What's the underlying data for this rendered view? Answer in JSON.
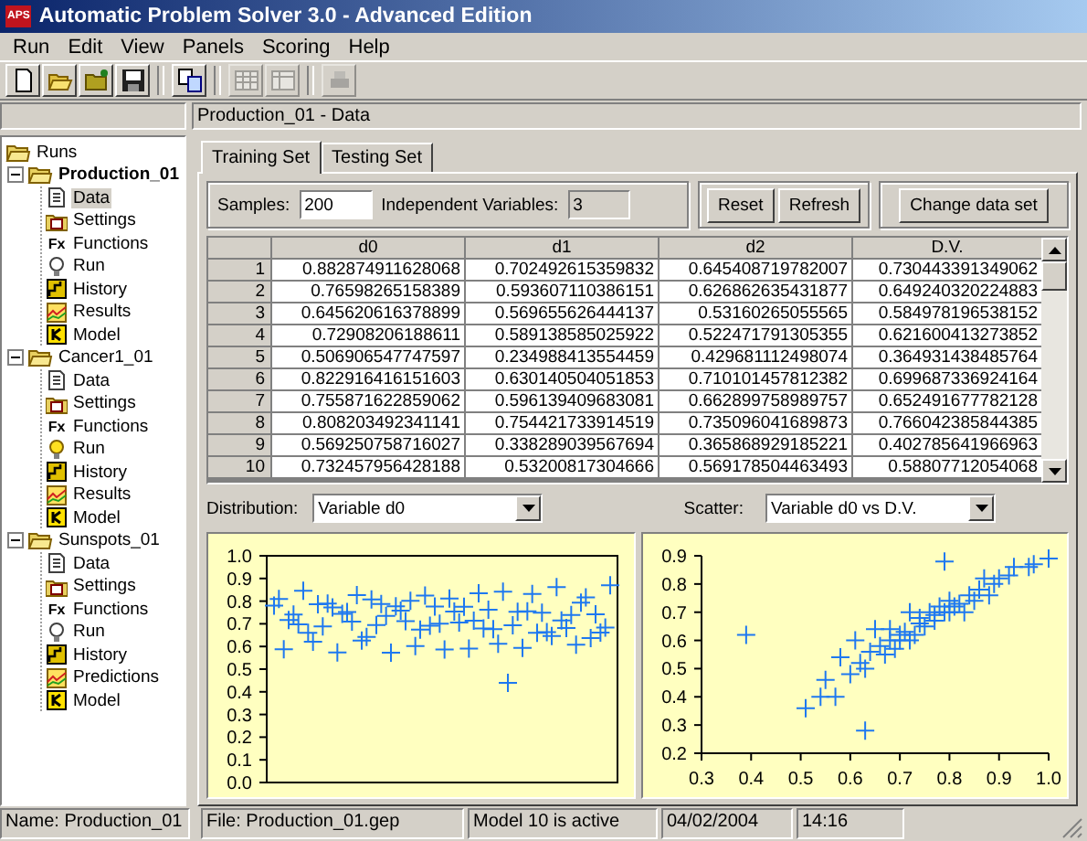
{
  "window": {
    "icon_text": "APS",
    "title": "Automatic Problem Solver 3.0 - Advanced Edition"
  },
  "menu": [
    "Run",
    "Edit",
    "View",
    "Panels",
    "Scoring",
    "Help"
  ],
  "toolbar": [
    [
      {
        "kind": "new",
        "disabled": false
      },
      {
        "kind": "open",
        "disabled": false
      },
      {
        "kind": "open_project",
        "disabled": false
      },
      {
        "kind": "save",
        "disabled": false
      }
    ],
    [
      {
        "kind": "copy",
        "disabled": false
      }
    ],
    [
      {
        "kind": "grid",
        "disabled": true
      },
      {
        "kind": "table",
        "disabled": true
      }
    ],
    [
      {
        "kind": "print",
        "disabled": true
      }
    ]
  ],
  "breadcrumb": "Production_01 - Data",
  "tree": {
    "label": "Runs",
    "children": [
      {
        "label": "Production_01",
        "active": true,
        "expanded": true,
        "children": [
          {
            "label": "Data",
            "kind": "data",
            "selected": true
          },
          {
            "label": "Settings",
            "kind": "settings",
            "selected": false
          },
          {
            "label": "Functions",
            "kind": "functions",
            "icon_text": "Fx",
            "selected": false
          },
          {
            "label": "Run",
            "kind": "run",
            "selected": false
          },
          {
            "label": "History",
            "kind": "history",
            "selected": false
          },
          {
            "label": "Results",
            "kind": "results",
            "selected": false
          },
          {
            "label": "Model",
            "kind": "model",
            "selected": false
          }
        ]
      },
      {
        "label": "Cancer1_01",
        "active": false,
        "expanded": true,
        "children": [
          {
            "label": "Data",
            "kind": "data",
            "selected": false
          },
          {
            "label": "Settings",
            "kind": "settings",
            "selected": false
          },
          {
            "label": "Functions",
            "kind": "functions",
            "icon_text": "Fx",
            "selected": false
          },
          {
            "label": "Run",
            "kind": "run_lit",
            "selected": false
          },
          {
            "label": "History",
            "kind": "history",
            "selected": false
          },
          {
            "label": "Results",
            "kind": "results",
            "selected": false
          },
          {
            "label": "Model",
            "kind": "model",
            "selected": false
          }
        ]
      },
      {
        "label": "Sunspots_01",
        "active": false,
        "expanded": true,
        "children": [
          {
            "label": "Data",
            "kind": "data",
            "selected": false
          },
          {
            "label": "Settings",
            "kind": "settings",
            "selected": false
          },
          {
            "label": "Functions",
            "kind": "functions",
            "icon_text": "Fx",
            "selected": false
          },
          {
            "label": "Run",
            "kind": "run",
            "selected": false
          },
          {
            "label": "History",
            "kind": "history",
            "selected": false
          },
          {
            "label": "Predictions",
            "kind": "results",
            "selected": false
          },
          {
            "label": "Model",
            "kind": "model",
            "selected": false
          }
        ]
      }
    ]
  },
  "tabs": [
    {
      "label": "Training Set",
      "selected": true
    },
    {
      "label": "Testing Set",
      "selected": false
    }
  ],
  "samples": {
    "label": "Samples:",
    "value": "200"
  },
  "independent_variables": {
    "label": "Independent Variables:",
    "value": "3",
    "disabled": true
  },
  "action_buttons": [
    "Reset",
    "Refresh"
  ],
  "change_button": "Change data set",
  "table": {
    "columns": [
      "d0",
      "d1",
      "d2",
      "D.V."
    ],
    "rows": [
      {
        "number": "1",
        "cells": [
          "0.882874911628068",
          "0.702492615359832",
          "0.645408719782007",
          "0.730443391349062"
        ]
      },
      {
        "number": "2",
        "cells": [
          "0.76598265158389",
          "0.593607110386151",
          "0.626862635431877",
          "0.649240320224883"
        ]
      },
      {
        "number": "3",
        "cells": [
          "0.645620616378899",
          "0.569655626444137",
          "0.53160265055565",
          "0.584978196538152"
        ]
      },
      {
        "number": "4",
        "cells": [
          "0.72908206188611",
          "0.589138585025922",
          "0.522471791305355",
          "0.621600413273852"
        ]
      },
      {
        "number": "5",
        "cells": [
          "0.506906547747597",
          "0.234988413554459",
          "0.429681112498074",
          "0.364931438485764"
        ]
      },
      {
        "number": "6",
        "cells": [
          "0.822916416151603",
          "0.630140504051853",
          "0.710101457812382",
          "0.699687336924164"
        ]
      },
      {
        "number": "7",
        "cells": [
          "0.755871622859062",
          "0.596139409683081",
          "0.662899758989757",
          "0.652491677782128"
        ]
      },
      {
        "number": "8",
        "cells": [
          "0.808203492341141",
          "0.754421733914519",
          "0.735096041689873",
          "0.766042385844385"
        ]
      },
      {
        "number": "9",
        "cells": [
          "0.569250758716027",
          "0.338289039567694",
          "0.365868929185221",
          "0.402785641966963"
        ]
      },
      {
        "number": "10",
        "cells": [
          "0.732457956428188",
          "0.53200817304666",
          "0.569178504463493",
          "0.58807712054068"
        ]
      }
    ]
  },
  "distribution": {
    "label": "Distribution:",
    "value": "Variable d0",
    "y_axis_labels": [
      "1.0",
      "0.9",
      "0.8",
      "0.7",
      "0.6",
      "0.5",
      "0.4",
      "0.3",
      "0.2",
      "0.1",
      "0.0"
    ]
  },
  "scatter": {
    "label": "Scatter:",
    "value": "Variable d0 vs D.V.",
    "chart_data": {
      "type": "scatter",
      "x": [
        0.39,
        0.51,
        0.54,
        0.55,
        0.57,
        0.58,
        0.6,
        0.61,
        0.62,
        0.63,
        0.63,
        0.64,
        0.65,
        0.66,
        0.67,
        0.68,
        0.68,
        0.69,
        0.7,
        0.7,
        0.71,
        0.72,
        0.72,
        0.73,
        0.74,
        0.74,
        0.75,
        0.76,
        0.77,
        0.77,
        0.78,
        0.79,
        0.79,
        0.8,
        0.8,
        0.81,
        0.82,
        0.83,
        0.84,
        0.85,
        0.86,
        0.87,
        0.88,
        0.89,
        0.9,
        0.92,
        0.93,
        0.96,
        0.97,
        1.0
      ],
      "series": [
        {
          "color": "#1e78f0",
          "values": [
            0.62,
            0.36,
            0.4,
            0.46,
            0.4,
            0.54,
            0.48,
            0.6,
            0.52,
            0.28,
            0.5,
            0.56,
            0.64,
            0.58,
            0.55,
            0.6,
            0.64,
            0.57,
            0.62,
            0.6,
            0.63,
            0.6,
            0.7,
            0.62,
            0.66,
            0.68,
            0.65,
            0.7,
            0.67,
            0.69,
            0.72,
            0.88,
            0.7,
            0.7,
            0.74,
            0.72,
            0.73,
            0.7,
            0.76,
            0.74,
            0.78,
            0.82,
            0.76,
            0.8,
            0.82,
            0.83,
            0.86,
            0.86,
            0.87,
            0.89
          ]
        }
      ],
      "xlim": [
        0.3,
        1.0
      ],
      "ylim": [
        0.2,
        0.9
      ],
      "xticks": [
        {
          "value": 0.3,
          "label": "0.3"
        },
        {
          "value": 0.4,
          "label": "0.4"
        },
        {
          "value": 0.5,
          "label": "0.5"
        },
        {
          "value": 0.6,
          "label": "0.6"
        },
        {
          "value": 0.7,
          "label": "0.7"
        },
        {
          "value": 0.8,
          "label": "0.8"
        },
        {
          "value": 0.9,
          "label": "0.9"
        },
        {
          "value": 1,
          "label": "1.0"
        }
      ],
      "yticks": [
        {
          "value": 0.2,
          "label": "0.2"
        },
        {
          "value": 0.3,
          "label": "0.3"
        },
        {
          "value": 0.4,
          "label": "0.4"
        },
        {
          "value": 0.5,
          "label": "0.5"
        },
        {
          "value": 0.6,
          "label": "0.6"
        },
        {
          "value": 0.7,
          "label": "0.7"
        },
        {
          "value": 0.8,
          "label": "0.8"
        },
        {
          "value": 0.9,
          "label": "0.9"
        }
      ]
    }
  },
  "status_bar": [
    "Name: Production_01",
    "File: Production_01.gep",
    "Model 10 is active",
    "04/02/2004",
    "14:16"
  ]
}
